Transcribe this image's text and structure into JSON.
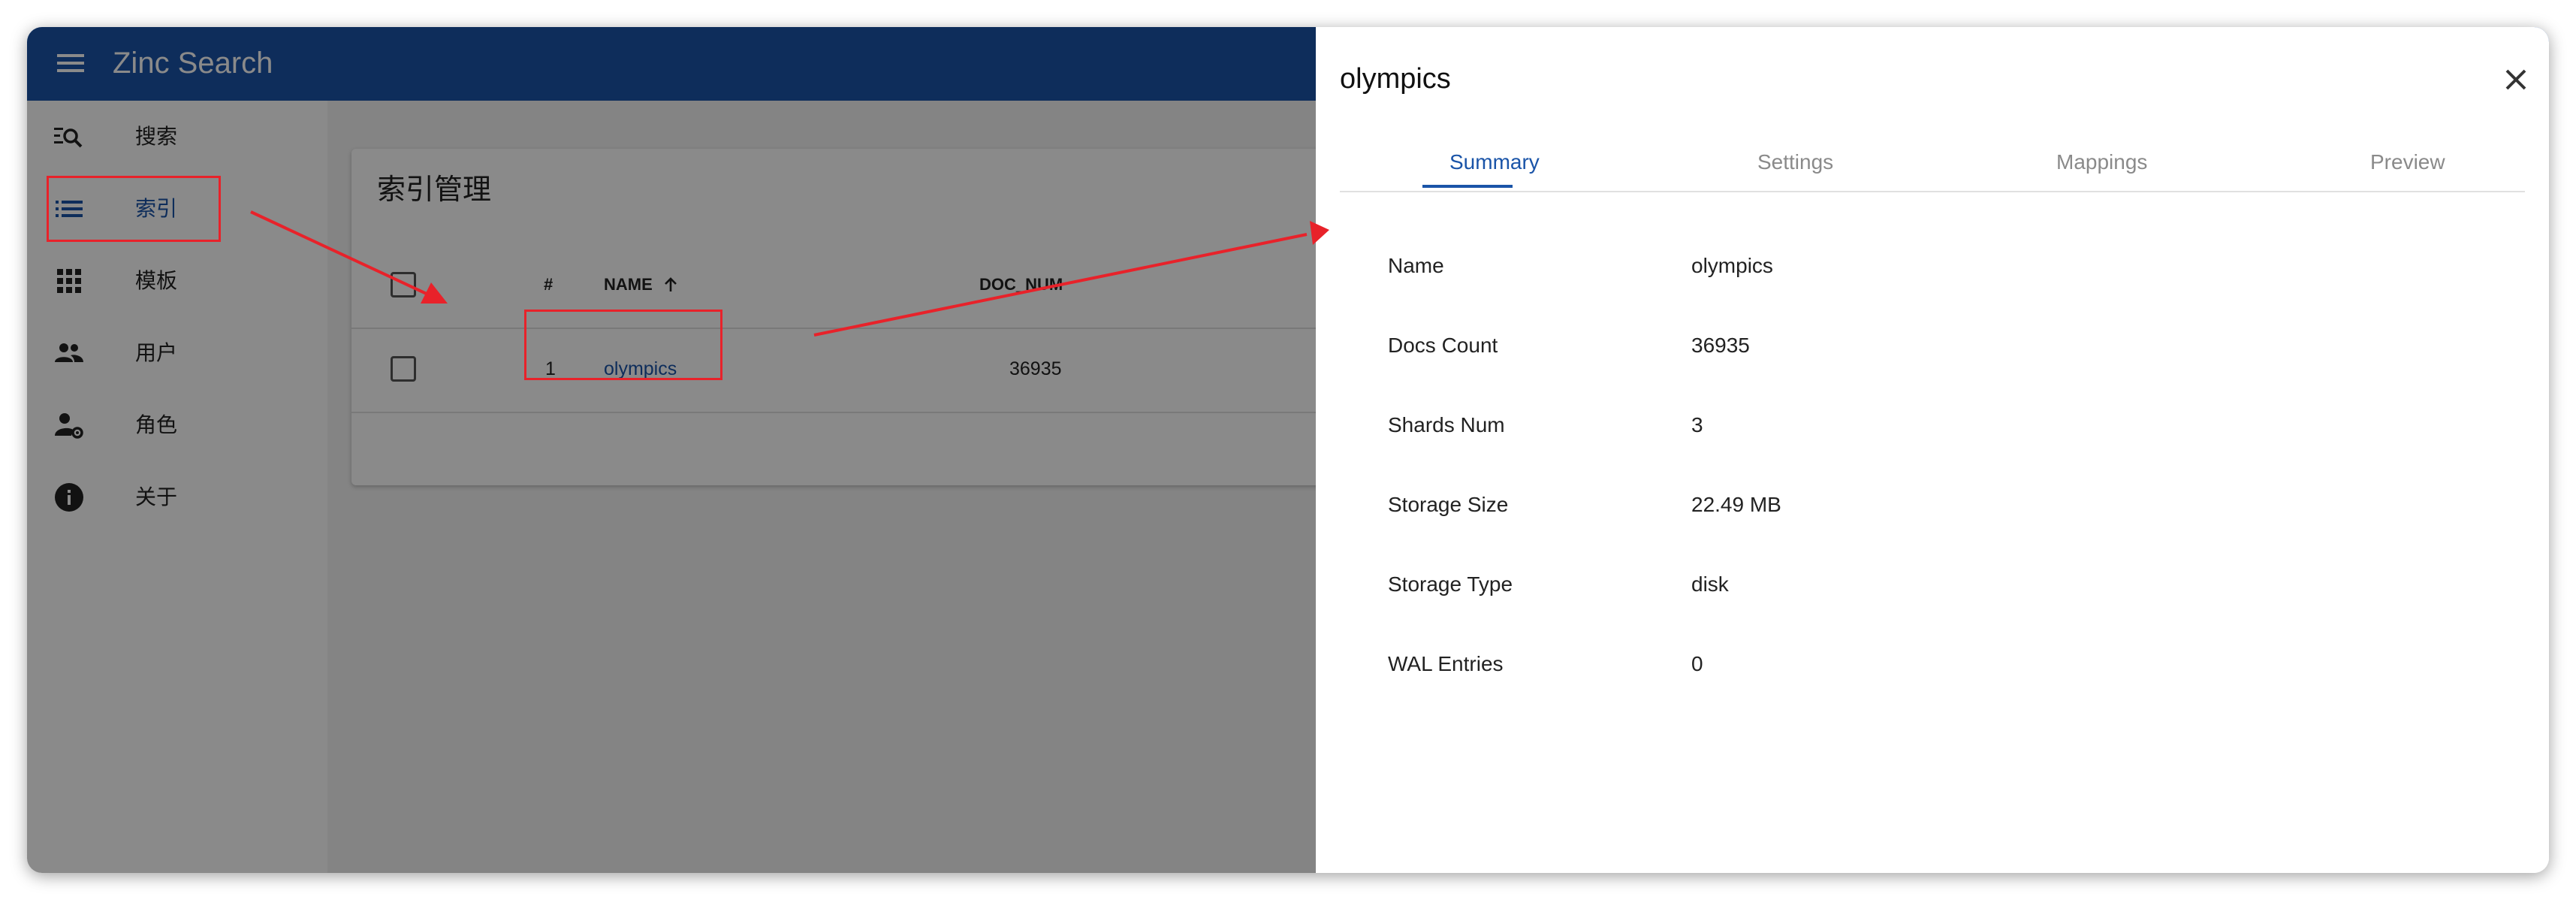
{
  "app": {
    "title": "Zinc Search"
  },
  "sidebar": {
    "items": [
      {
        "label": "搜索",
        "icon": "search-list-icon"
      },
      {
        "label": "索引",
        "icon": "list-icon"
      },
      {
        "label": "模板",
        "icon": "grid-icon"
      },
      {
        "label": "用户",
        "icon": "people-icon"
      },
      {
        "label": "角色",
        "icon": "manage-accounts-icon"
      },
      {
        "label": "关于",
        "icon": "info-icon"
      }
    ],
    "active_index": 1
  },
  "index_page": {
    "title": "索引管理",
    "columns": {
      "num": "#",
      "name": "NAME",
      "sort_icon": "arrow-up-icon",
      "doc_num": "DOC_NUM"
    },
    "rows": [
      {
        "num": "1",
        "name": "olympics",
        "doc_num": "36935"
      }
    ]
  },
  "drawer": {
    "title": "olympics",
    "close_icon": "close-icon",
    "tabs": [
      {
        "label": "Summary"
      },
      {
        "label": "Settings"
      },
      {
        "label": "Mappings"
      },
      {
        "label": "Preview"
      }
    ],
    "active_tab": 0,
    "summary": [
      {
        "label": "Name",
        "value": "olympics"
      },
      {
        "label": "Docs Count",
        "value": "36935"
      },
      {
        "label": "Shards Num",
        "value": "3"
      },
      {
        "label": "Storage Size",
        "value": "22.49 MB"
      },
      {
        "label": "Storage Type",
        "value": "disk"
      },
      {
        "label": "WAL Entries",
        "value": "0"
      }
    ]
  },
  "colors": {
    "header": "#1a54a8",
    "accent": "#1a54a8",
    "annotation": "#e8222a"
  }
}
